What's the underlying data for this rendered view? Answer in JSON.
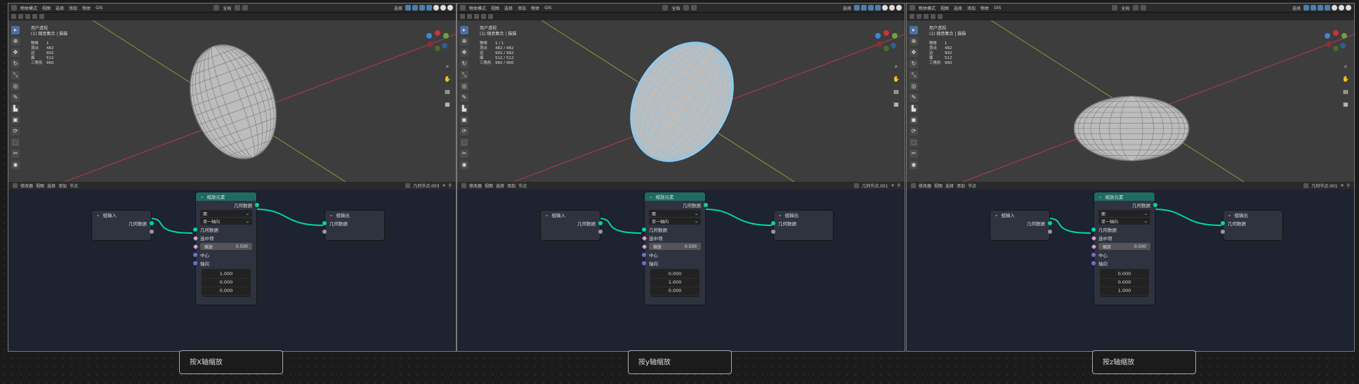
{
  "toolbar": {
    "mode": "物体模式",
    "menu": [
      "视图",
      "选择",
      "添加",
      "物体",
      "GIS"
    ],
    "transform_space": "全局",
    "shading": "选择"
  },
  "viewport_overlay": {
    "view_label": "用户透视",
    "collection_label": "(1) 随意集合 | 猫猫"
  },
  "panels": [
    {
      "id": "x",
      "stats": [
        {
          "label": "物体",
          "value": "1"
        },
        {
          "label": "顶点",
          "value": "482"
        },
        {
          "label": "边",
          "value": "992"
        },
        {
          "label": "面",
          "value": "512"
        },
        {
          "label": "三角形",
          "value": "960"
        }
      ],
      "node_tree": "几何节点.003",
      "breadcrumb": [
        "猫猫",
        "几何节点",
        "几何节点.003"
      ],
      "vector": [
        "1.000",
        "0.000",
        "0.000"
      ],
      "caption": "按X轴缩放"
    },
    {
      "id": "y",
      "stats": [
        {
          "label": "物体",
          "value": "1 / 1"
        },
        {
          "label": "顶点",
          "value": "482 / 482"
        },
        {
          "label": "边",
          "value": "992 / 992"
        },
        {
          "label": "面",
          "value": "512 / 512"
        },
        {
          "label": "三角形",
          "value": "960 / 960"
        }
      ],
      "node_tree": "几何节点.001",
      "breadcrumb": [
        "猫猫",
        "几何节点",
        "几何节点.001"
      ],
      "vector": [
        "0.000",
        "1.000",
        "0.000"
      ],
      "caption": "按y轴缩放"
    },
    {
      "id": "z",
      "stats": [
        {
          "label": "物体",
          "value": "1"
        },
        {
          "label": "顶点",
          "value": "482"
        },
        {
          "label": "边",
          "value": "992"
        },
        {
          "label": "面",
          "value": "512"
        },
        {
          "label": "三角形",
          "value": "960"
        }
      ],
      "node_tree": "几何节点.001",
      "breadcrumb": [
        "猫猫",
        "几何节点",
        "几何节点.001"
      ],
      "vector": [
        "0.000",
        "0.000",
        "1.000"
      ],
      "caption": "按z轴缩放"
    }
  ],
  "node_editor": {
    "editor_type": "修改器",
    "menu": [
      "视图",
      "选择",
      "添加",
      "节点"
    ]
  },
  "nodes": {
    "group_input": {
      "title": "组输入",
      "output": "几何数据"
    },
    "scale_elements": {
      "title": "缩放元素",
      "output": "几何数据",
      "domain": "面",
      "mode": "单一轴向",
      "inputs": [
        "几何数据",
        "选中项"
      ],
      "scale_label": "缩放",
      "scale_value": "0.500",
      "center": "中心",
      "axis": "轴向"
    },
    "group_output": {
      "title": "组输出",
      "input": "几何数据"
    }
  },
  "colors": {
    "geo_socket": "#00d6a3",
    "node_header": "#1f6b63",
    "selection": "#8fd3ff"
  }
}
